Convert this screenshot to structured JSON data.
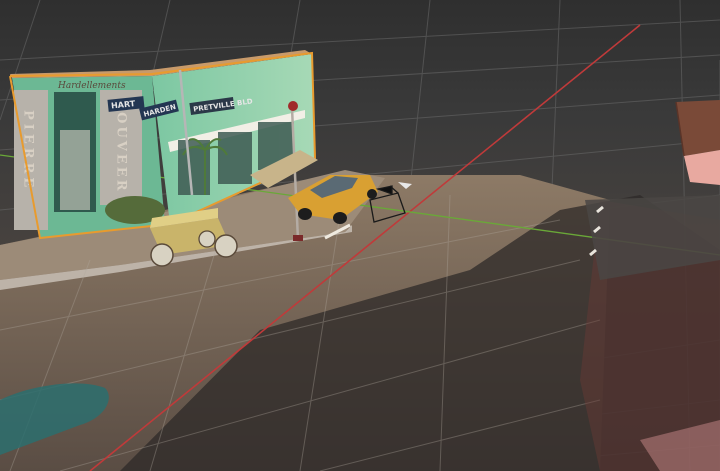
{
  "viewport": {
    "label": "3D scene viewport"
  },
  "scene": {
    "building_name_left": "PIERRE",
    "building_name_right": "LOUVEER",
    "script_sign": "Hardellements",
    "street_sign_a": "HART",
    "street_sign_b": "HARDEN",
    "street_sign_c": "PRETVILLE BLD",
    "colors": {
      "selection_outline": "#e89b2e",
      "x_axis": "#c03a3a",
      "z_axis": "#6aa838",
      "grid": "#6a6a6a",
      "facade_green": "#6fbf9a",
      "taxi_yellow": "#d9a032"
    }
  }
}
